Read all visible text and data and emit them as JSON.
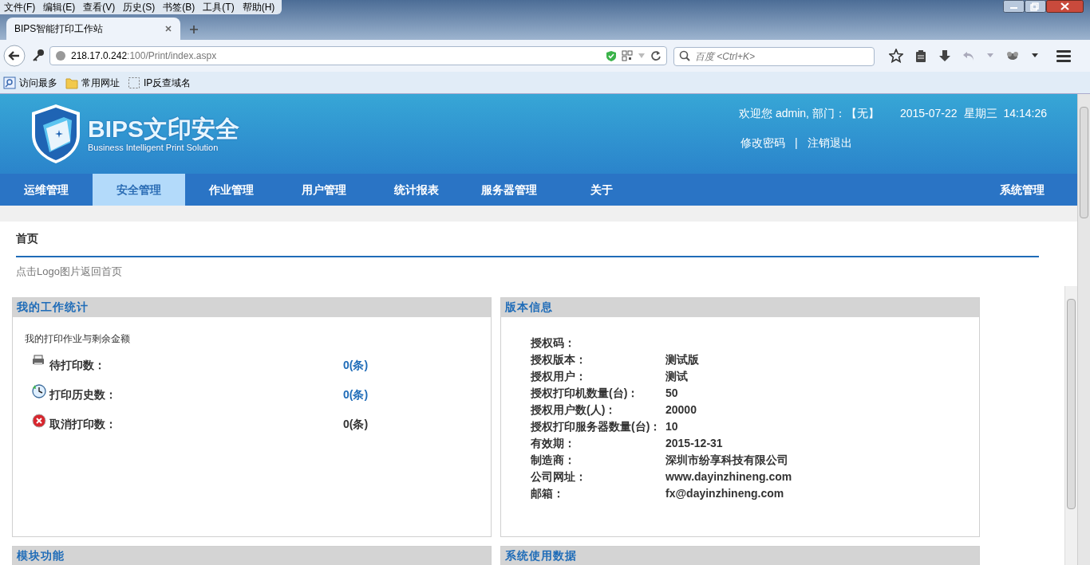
{
  "browser": {
    "menu": [
      "文件(F)",
      "编辑(E)",
      "查看(V)",
      "历史(S)",
      "书签(B)",
      "工具(T)",
      "帮助(H)"
    ],
    "tab": {
      "title": "BIPS智能打印工作站",
      "selected": true
    },
    "url": {
      "host": "218.17.0.242",
      "path": ":100/Print/index.aspx"
    },
    "search": {
      "placeholder": "百度 <Ctrl+K>"
    },
    "bookmarks": [
      {
        "kind": "most",
        "label": "访问最多"
      },
      {
        "kind": "folder",
        "label": "常用网址"
      },
      {
        "kind": "page",
        "label": "IP反查域名"
      }
    ]
  },
  "header": {
    "logo_title": "BIPS文印安全",
    "logo_subtitle": "Business Intelligent Print Solution",
    "welcome": "欢迎您 admin, 部门：【无】",
    "date": "2015-07-22",
    "weekday": "星期三",
    "time": "14:14:26",
    "links": [
      "修改密码",
      "注销退出"
    ],
    "separator": "|"
  },
  "nav": {
    "items": [
      {
        "label": "运维管理",
        "selected": false
      },
      {
        "label": "安全管理",
        "selected": true
      },
      {
        "label": "作业管理",
        "selected": false
      },
      {
        "label": "用户管理",
        "selected": false
      },
      {
        "label": "统计报表",
        "selected": false
      },
      {
        "label": "服务器管理",
        "selected": false
      },
      {
        "label": "关于",
        "selected": false
      }
    ],
    "right_item": "系统管理"
  },
  "breadcrumb": "首页",
  "hint": "点击Logo图片返回首页",
  "stats_panel": {
    "title": "我的工作统计",
    "subtitle": "我的打印作业与剩余金额",
    "rows": [
      {
        "kind": "printer",
        "label": "待打印数：",
        "value": "0(条)",
        "linked": true
      },
      {
        "kind": "clock",
        "label": "打印历史数：",
        "value": "0(条)",
        "linked": true
      },
      {
        "kind": "cancel",
        "label": "取消打印数：",
        "value": "0(条)",
        "linked": false
      }
    ]
  },
  "version_panel": {
    "title": "版本信息",
    "rows": [
      {
        "label": "授权码："
      },
      {
        "label": "授权版本：",
        "value": "测试版"
      },
      {
        "label": "授权用户：",
        "value": "测试"
      },
      {
        "label": "授权打印机数量(台)：",
        "value": "50"
      },
      {
        "label": "授权用户数(人)：",
        "value": "20000"
      },
      {
        "label": "授权打印服务器数量(台)：",
        "value": "10"
      },
      {
        "label": "有效期：",
        "value": "2015-12-31"
      },
      {
        "label": "制造商：",
        "value": "深圳市纷享科技有限公司"
      },
      {
        "label": "公司网址：",
        "value": "www.dayinzhineng.com"
      },
      {
        "label": "邮箱：",
        "value": "fx@dayinzhineng.com"
      }
    ]
  },
  "bottom_panels": [
    {
      "title": "模块功能"
    },
    {
      "title": "系统使用数据"
    }
  ]
}
